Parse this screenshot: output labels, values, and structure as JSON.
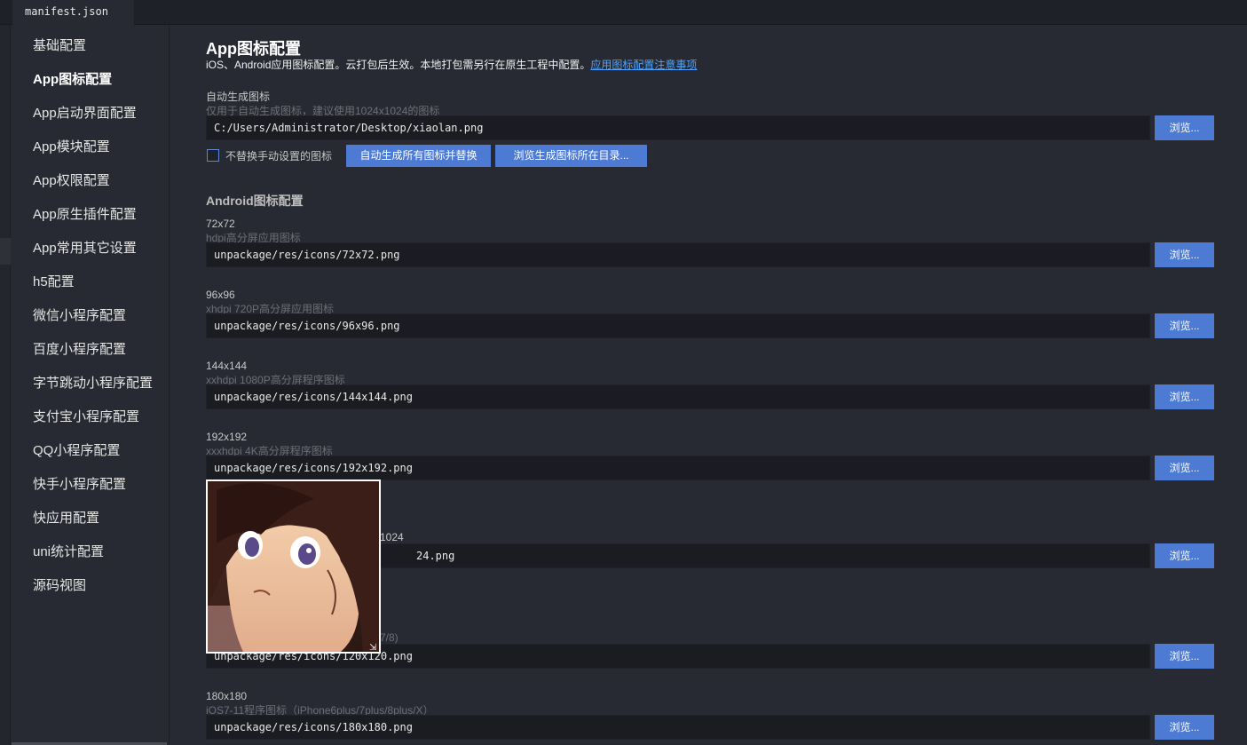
{
  "tab": {
    "title": "manifest.json"
  },
  "sidebar": {
    "items": [
      {
        "label": "基础配置"
      },
      {
        "label": "App图标配置"
      },
      {
        "label": "App启动界面配置"
      },
      {
        "label": "App模块配置"
      },
      {
        "label": "App权限配置"
      },
      {
        "label": "App原生插件配置"
      },
      {
        "label": "App常用其它设置"
      },
      {
        "label": "h5配置"
      },
      {
        "label": "微信小程序配置"
      },
      {
        "label": "百度小程序配置"
      },
      {
        "label": "字节跳动小程序配置"
      },
      {
        "label": "支付宝小程序配置"
      },
      {
        "label": "QQ小程序配置"
      },
      {
        "label": "快手小程序配置"
      },
      {
        "label": "快应用配置"
      },
      {
        "label": "uni统计配置"
      },
      {
        "label": "源码视图"
      }
    ]
  },
  "main": {
    "title": "App图标配置",
    "description": "iOS、Android应用图标配置。云打包后生效。本地打包需另行在原生工程中配置。",
    "link": "应用图标配置注意事项",
    "auto": {
      "label": "自动生成图标",
      "hint": "仅用于自动生成图标，建议使用1024x1024的图标",
      "value": "C:/Users/Administrator/Desktop/xiaolan.png",
      "checkbox_label": "不替换手动设置的图标",
      "generate_button": "自动生成所有图标并替换",
      "browse_dir_button": "浏览生成图标所在目录..."
    },
    "android_title": "Android图标配置",
    "browse_label": "浏览...",
    "icons": [
      {
        "label": "72x72",
        "hint": "hdpi高分屏应用图标",
        "value": "unpackage/res/icons/72x72.png"
      },
      {
        "label": "96x96",
        "hint": "xhdpi 720P高分屏应用图标",
        "value": "unpackage/res/icons/96x96.png"
      },
      {
        "label": "144x144",
        "hint": "xxhdpi 1080P高分屏程序图标",
        "value": "unpackage/res/icons/144x144.png"
      },
      {
        "label": "192x192",
        "hint": "xxxhdpi 4K高分屏程序图标",
        "value": "unpackage/res/icons/192x192.png"
      },
      {
        "label": "1024",
        "hint": "",
        "value": "24.png"
      },
      {
        "label": "",
        "hint": "7/8)",
        "value": "unpackage/res/icons/120x120.png"
      },
      {
        "label": "180x180",
        "hint": "iOS7-11程序图标（iPhone6plus/7plus/8plus/X）",
        "value": "unpackage/res/icons/180x180.png"
      }
    ]
  },
  "preview": {
    "icon": "anime-girl-preview-image"
  }
}
